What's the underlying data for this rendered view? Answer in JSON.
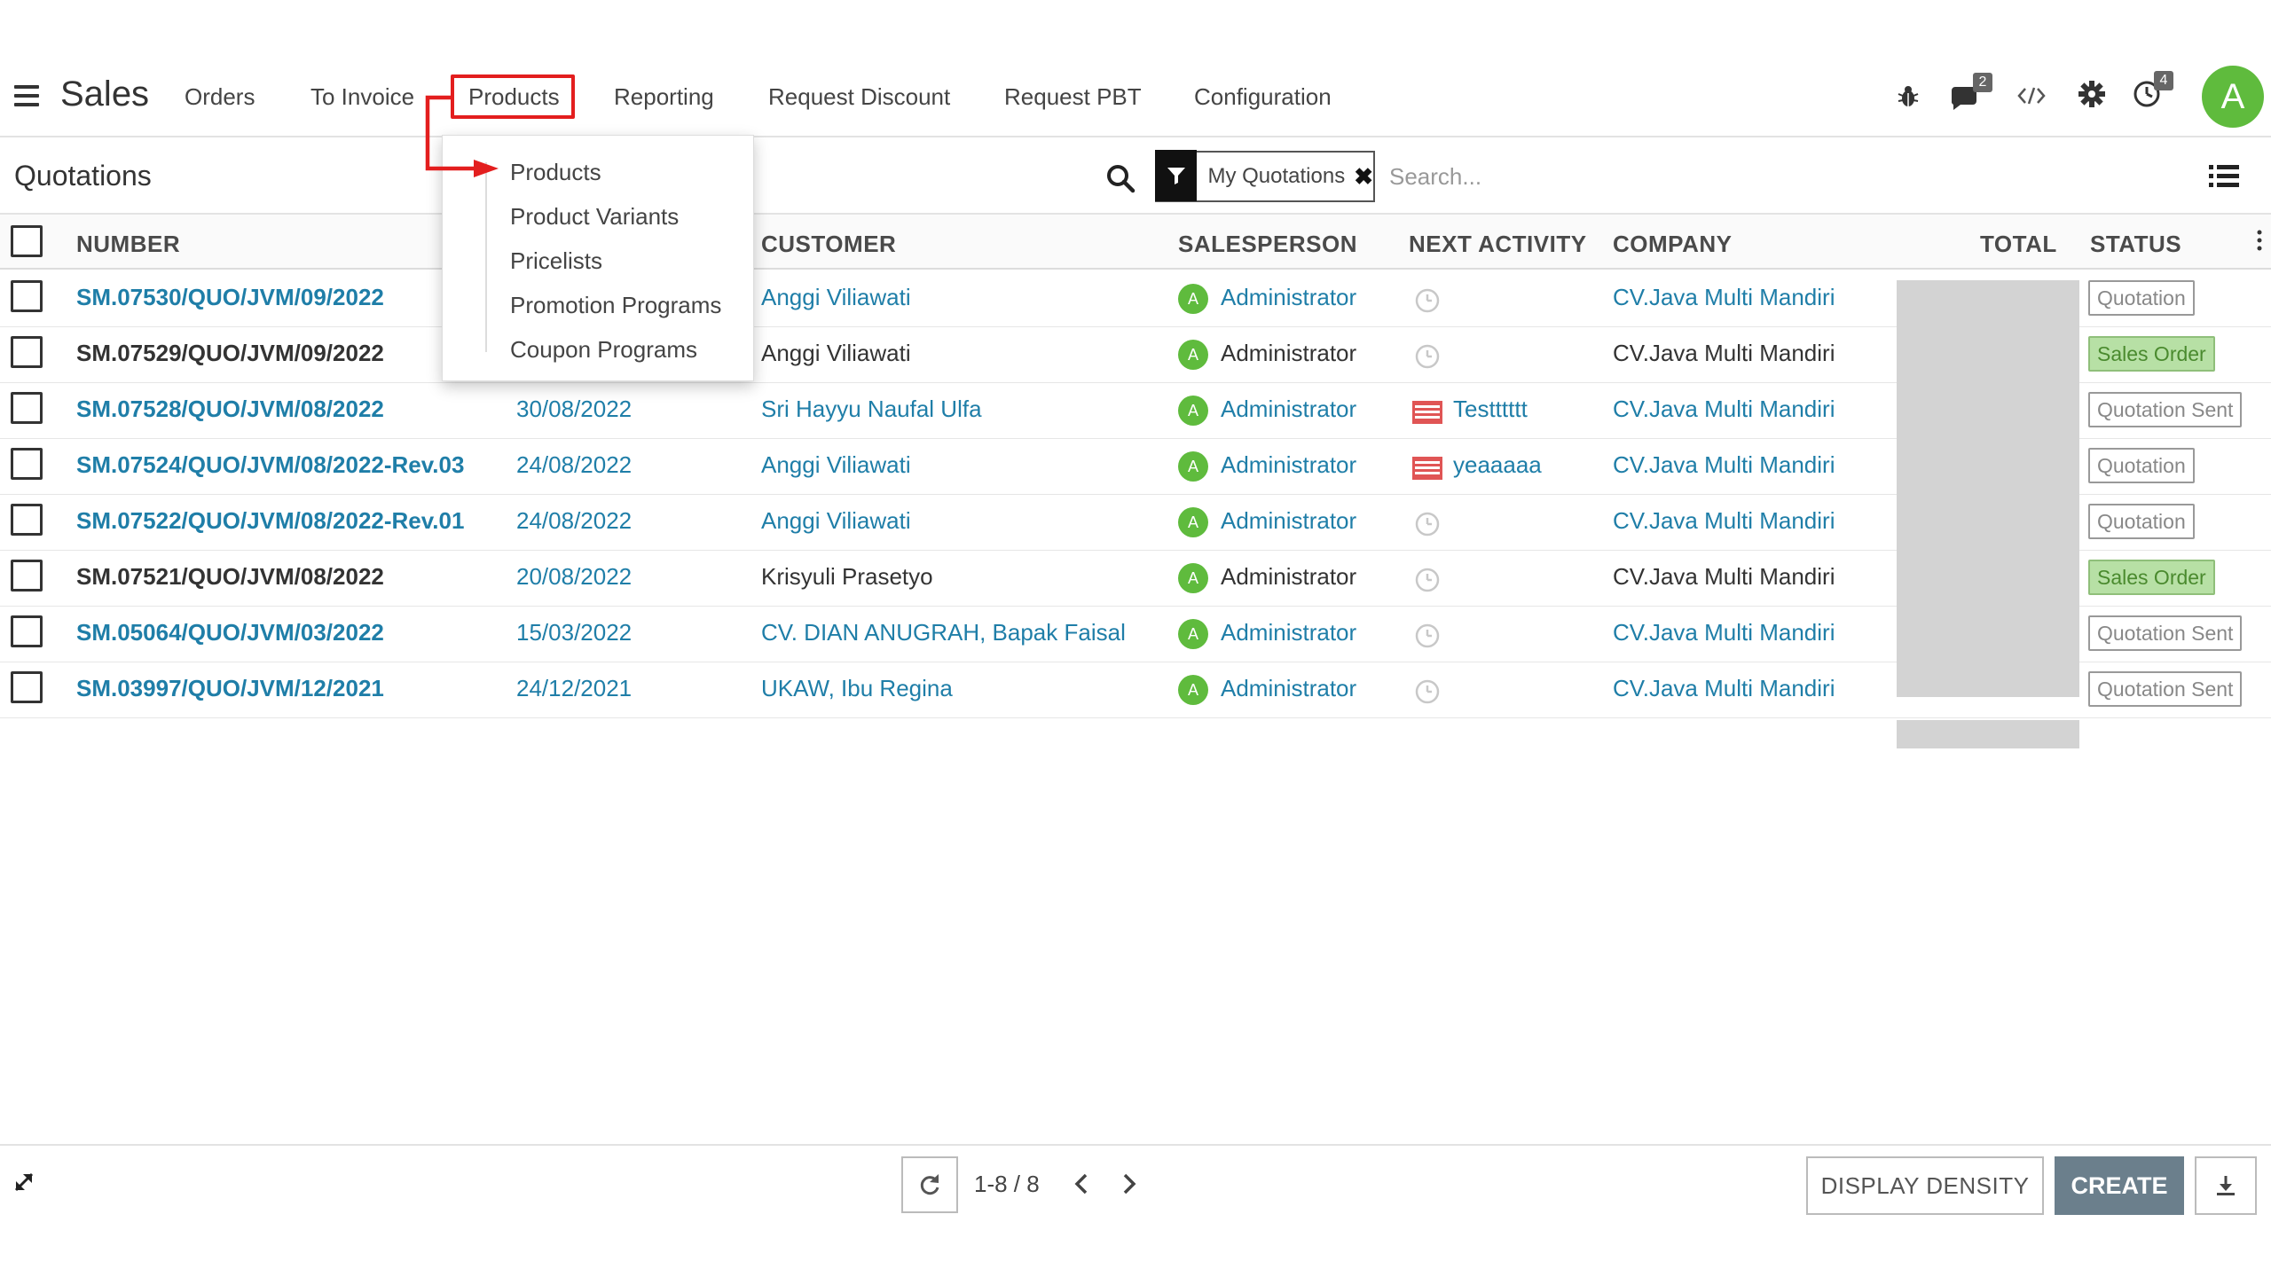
{
  "nav": {
    "app_title": "Sales",
    "menu": [
      "Orders",
      "To Invoice",
      "Products",
      "Reporting",
      "Request Discount",
      "Request PBT",
      "Configuration"
    ],
    "messages_badge": "2",
    "activity_badge": "4",
    "avatar_letter": "A"
  },
  "dropdown": {
    "items": [
      "Products",
      "Product Variants",
      "Pricelists",
      "Promotion Programs",
      "Coupon Programs"
    ]
  },
  "control": {
    "breadcrumb": "Quotations",
    "facet_label": "My Quotations",
    "facet_close": "✖",
    "search_placeholder": "Search..."
  },
  "table": {
    "headers": {
      "number": "NUMBER",
      "customer": "CUSTOMER",
      "salesperson": "SALESPERSON",
      "next_activity": "NEXT ACTIVITY",
      "company": "COMPANY",
      "total": "TOTAL",
      "status": "STATUS"
    },
    "rows": [
      {
        "number": "SM.07530/QUO/JVM/09/2022",
        "date": "",
        "customer": "Anggi Viliawati",
        "salesperson": "Administrator",
        "activity": "",
        "company": "CV.Java Multi Mandiri",
        "status": "Quotation"
      },
      {
        "number": "SM.07529/QUO/JVM/09/2022",
        "date": "",
        "customer": "Anggi Viliawati",
        "salesperson": "Administrator",
        "activity": "",
        "company": "CV.Java Multi Mandiri",
        "status": "Sales Order"
      },
      {
        "number": "SM.07528/QUO/JVM/08/2022",
        "date": "30/08/2022",
        "customer": "Sri Hayyu Naufal Ulfa",
        "salesperson": "Administrator",
        "activity": "Testttttt",
        "company": "CV.Java Multi Mandiri",
        "status": "Quotation Sent"
      },
      {
        "number": "SM.07524/QUO/JVM/08/2022-Rev.03",
        "date": "24/08/2022",
        "customer": "Anggi Viliawati",
        "salesperson": "Administrator",
        "activity": "yeaaaaa",
        "company": "CV.Java Multi Mandiri",
        "status": "Quotation"
      },
      {
        "number": "SM.07522/QUO/JVM/08/2022-Rev.01",
        "date": "24/08/2022",
        "customer": "Anggi Viliawati",
        "salesperson": "Administrator",
        "activity": "",
        "company": "CV.Java Multi Mandiri",
        "status": "Quotation"
      },
      {
        "number": "SM.07521/QUO/JVM/08/2022",
        "date": "20/08/2022",
        "customer": "Krisyuli Prasetyo",
        "salesperson": "Administrator",
        "activity": "",
        "company": "CV.Java Multi Mandiri",
        "status": "Sales Order"
      },
      {
        "number": "SM.05064/QUO/JVM/03/2022",
        "date": "15/03/2022",
        "customer": "CV. DIAN ANUGRAH, Bapak Faisal",
        "salesperson": "Administrator",
        "activity": "",
        "company": "CV.Java Multi Mandiri",
        "status": "Quotation Sent"
      },
      {
        "number": "SM.03997/QUO/JVM/12/2021",
        "date": "24/12/2021",
        "customer": "UKAW, Ibu Regina",
        "salesperson": "Administrator",
        "activity": "",
        "company": "CV.Java Multi Mandiri",
        "status": "Quotation Sent"
      }
    ]
  },
  "footer": {
    "pager": "1-8 / 8",
    "display_density": "DISPLAY DENSITY",
    "create": "CREATE"
  },
  "colors": {
    "link": "#1f7ea8",
    "highlight": "#e31e1e",
    "avatar": "#5fbb3d",
    "create_button": "#6b7f8c"
  }
}
